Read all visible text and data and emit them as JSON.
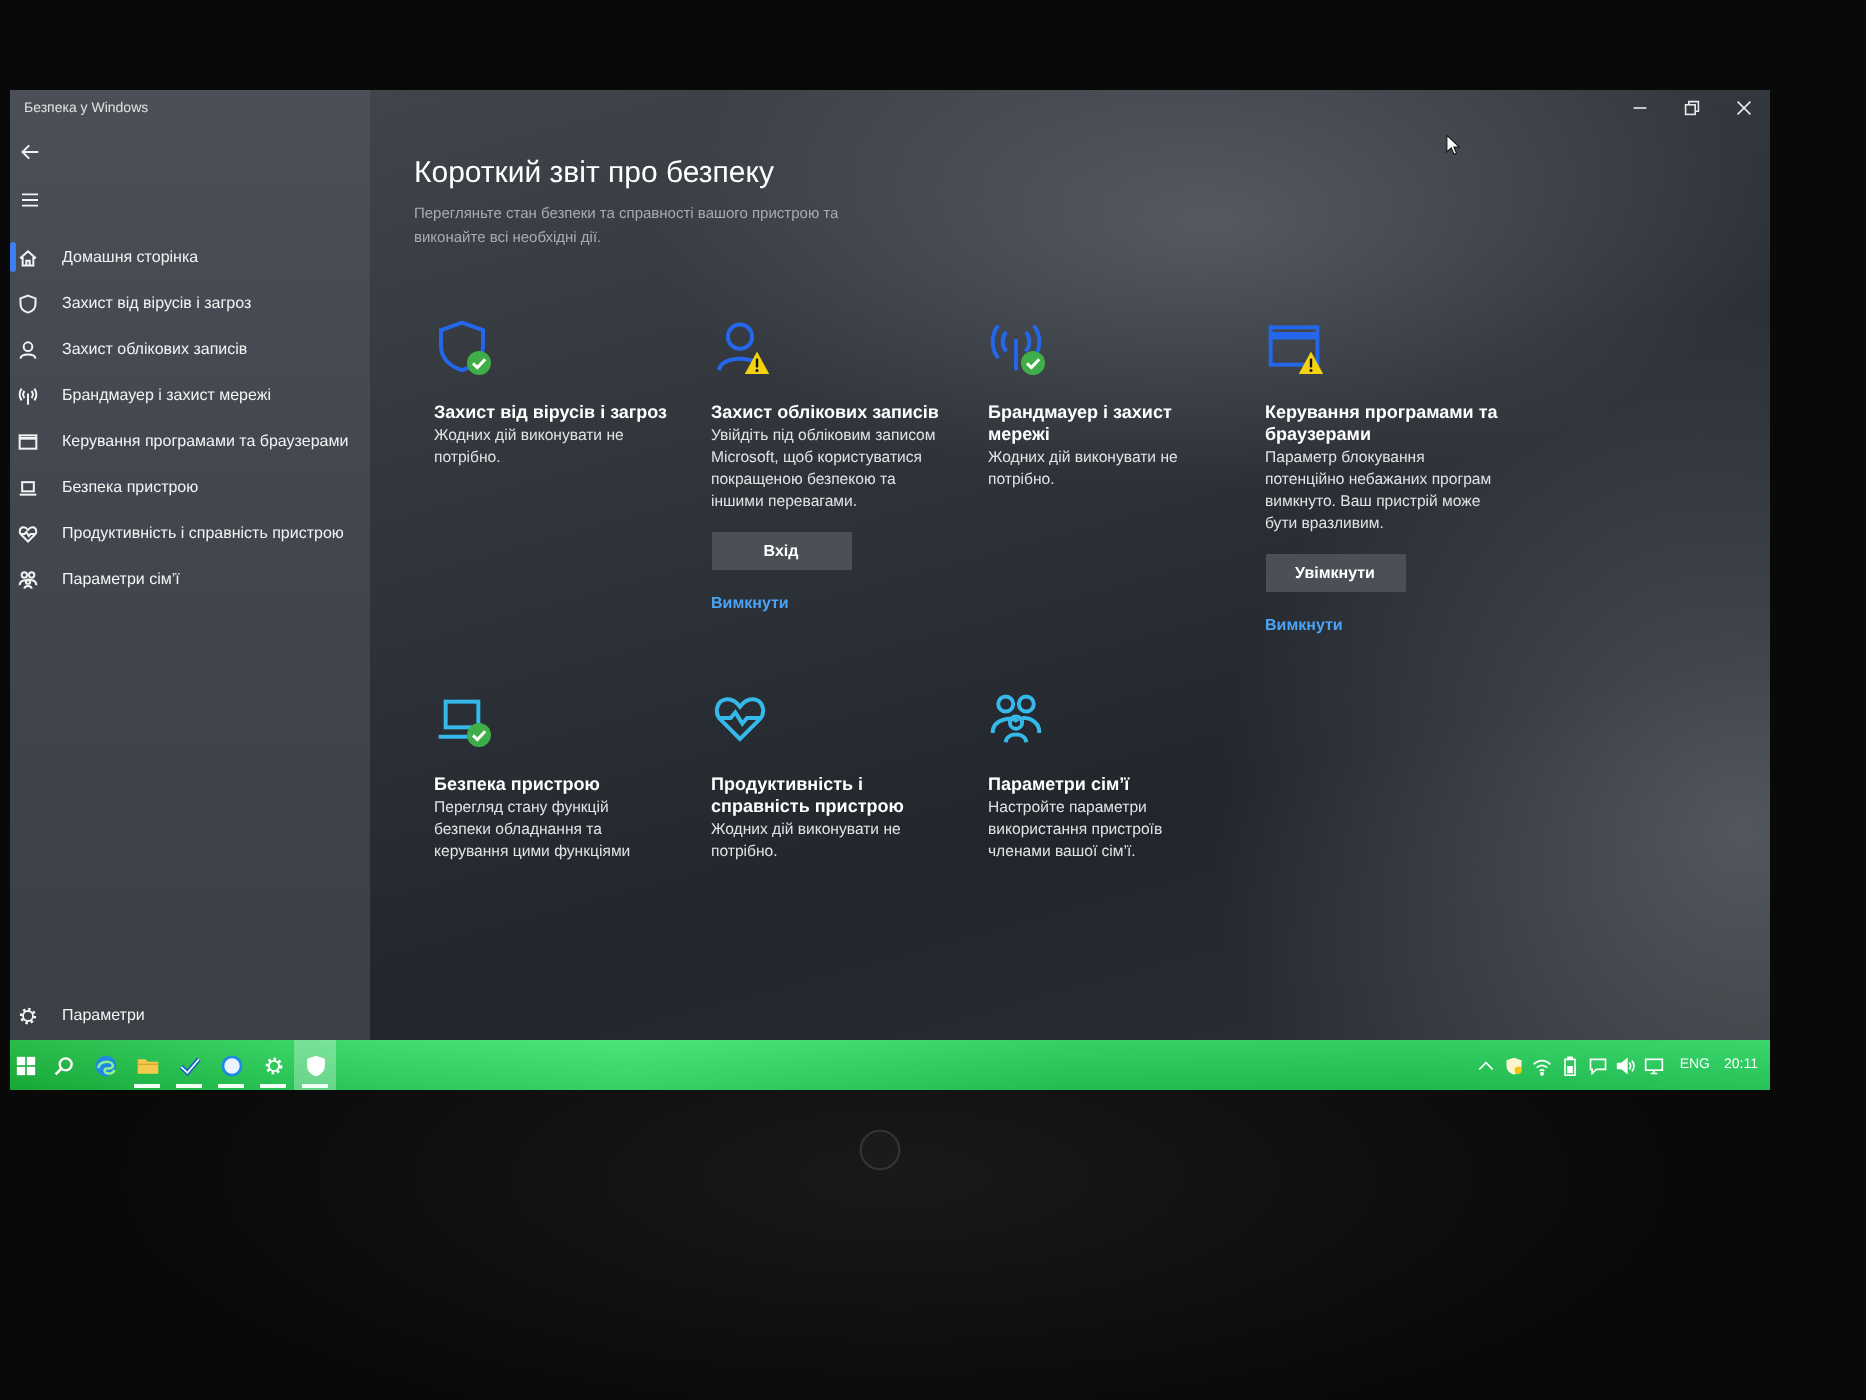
{
  "window": {
    "title": "Безпека у Windows"
  },
  "sidebar": {
    "items": [
      {
        "label": "Домашня сторінка",
        "selected": true
      },
      {
        "label": "Захист від вірусів і загроз",
        "selected": false
      },
      {
        "label": "Захист облікових записів",
        "selected": false
      },
      {
        "label": "Брандмауер і захист мережі",
        "selected": false
      },
      {
        "label": "Керування програмами та браузерами",
        "selected": false
      },
      {
        "label": "Безпека пристрою",
        "selected": false
      },
      {
        "label": "Продуктивність і справність пристрою",
        "selected": false
      },
      {
        "label": "Параметри сім’ї",
        "selected": false
      }
    ],
    "footer": {
      "label": "Параметри"
    }
  },
  "page": {
    "title": "Короткий звіт про безпеку",
    "subtitle": "Перегляньте стан безпеки та справності вашого пристрою та виконайте всі необхідні дії."
  },
  "cards": [
    {
      "title": "Захист від вірусів і загроз",
      "warning": false,
      "description": "Жодних дій виконувати не потрібно."
    },
    {
      "title": "Захист облікових записів",
      "warning": true,
      "description": "Увійдіть під обліковим записом Microsoft, щоб користуватися покращеною безпекою та іншими перевагами.",
      "button": "Вхід",
      "link": "Вимкнути"
    },
    {
      "title": "Брандмауер і захист мережі",
      "warning": false,
      "description": "Жодних дій виконувати не потрібно."
    },
    {
      "title": "Керування програмами та браузерами",
      "warning": true,
      "description": "Параметр блокування потенційно небажаних програм вимкнуто. Ваш пристрій може бути вразливим.",
      "button": "Увімкнути",
      "link": "Вимкнути"
    },
    {
      "title": "Безпека пристрою",
      "warning": false,
      "description": "Перегляд стану функцій безпеки обладнання та керування цими функціями"
    },
    {
      "title": "Продуктивність і справність пристрою",
      "description": "Жодних дій виконувати не потрібно."
    },
    {
      "title": "Параметри сім’ї",
      "description": "Настройте параметри використання пристроїв членами вашої сім’ї."
    }
  ],
  "taskbar": {
    "apps": [
      {
        "running": false,
        "active": false
      },
      {
        "running": true,
        "active": false
      },
      {
        "running": true,
        "active": false
      },
      {
        "running": true,
        "active": false
      },
      {
        "running": true,
        "active": false
      },
      {
        "running": true,
        "active": true
      }
    ],
    "tray": {
      "language": "ENG",
      "time": "20:11"
    }
  }
}
